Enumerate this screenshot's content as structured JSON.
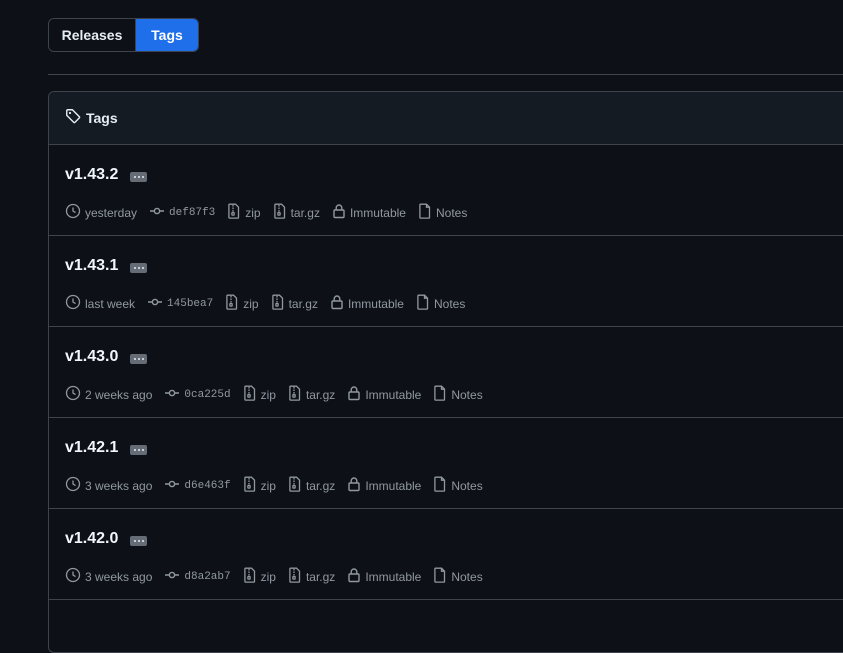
{
  "toggle": {
    "releases_label": "Releases",
    "tags_label": "Tags"
  },
  "panel": {
    "title": "Tags"
  },
  "tags": [
    {
      "name": "v1.43.2",
      "time": "yesterday",
      "sha": "def87f3",
      "zip": "zip",
      "targz": "tar.gz",
      "immutable": "Immutable",
      "notes": "Notes"
    },
    {
      "name": "v1.43.1",
      "time": "last week",
      "sha": "145bea7",
      "zip": "zip",
      "targz": "tar.gz",
      "immutable": "Immutable",
      "notes": "Notes"
    },
    {
      "name": "v1.43.0",
      "time": "2 weeks ago",
      "sha": "0ca225d",
      "zip": "zip",
      "targz": "tar.gz",
      "immutable": "Immutable",
      "notes": "Notes"
    },
    {
      "name": "v1.42.1",
      "time": "3 weeks ago",
      "sha": "d6e463f",
      "zip": "zip",
      "targz": "tar.gz",
      "immutable": "Immutable",
      "notes": "Notes"
    },
    {
      "name": "v1.42.0",
      "time": "3 weeks ago",
      "sha": "d8a2ab7",
      "zip": "zip",
      "targz": "tar.gz",
      "immutable": "Immutable",
      "notes": "Notes"
    }
  ],
  "colors": {
    "background": "#0d1117",
    "accent": "#1f6feb",
    "border": "#3d444d",
    "muted": "#9198a1"
  }
}
